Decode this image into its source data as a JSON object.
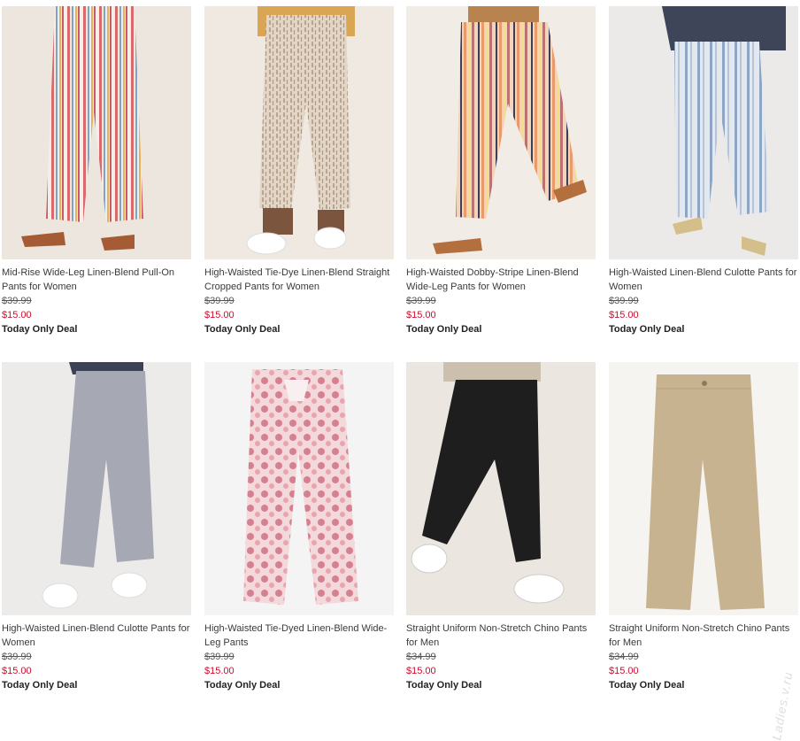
{
  "products": [
    {
      "title": "Mid-Rise Wide-Leg Linen-Blend Pull-On Pants for Women",
      "was_price": "$39.99",
      "price": "$15.00",
      "deal": "Today Only Deal",
      "image": "striped-wide-leg-pants-red-blue"
    },
    {
      "title": "High-Waisted Tie-Dye Linen-Blend Straight Cropped Pants for Women",
      "was_price": "$39.99",
      "price": "$15.00",
      "deal": "Today Only Deal",
      "image": "tie-dye-cropped-pants-beige"
    },
    {
      "title": "High-Waisted Dobby-Stripe Linen-Blend Wide-Leg Pants for Women",
      "was_price": "$39.99",
      "price": "$15.00",
      "deal": "Today Only Deal",
      "image": "dobby-stripe-wide-leg-pants-multicolor"
    },
    {
      "title": "High-Waisted Linen-Blend Culotte Pants for Women",
      "was_price": "$39.99",
      "price": "$15.00",
      "deal": "Today Only Deal",
      "image": "striped-culotte-pants-blue"
    },
    {
      "title": "High-Waisted Linen-Blend Culotte Pants for Women",
      "was_price": "$39.99",
      "price": "$15.00",
      "deal": "Today Only Deal",
      "image": "culotte-pants-gray"
    },
    {
      "title": "High-Waisted Tie-Dyed Linen-Blend Wide-Leg Pants",
      "was_price": "$39.99",
      "price": "$15.00",
      "deal": "Today Only Deal",
      "image": "tie-dyed-wide-leg-pants-pink"
    },
    {
      "title": "Straight Uniform Non-Stretch Chino Pants for Men",
      "was_price": "$34.99",
      "price": "$15.00",
      "deal": "Today Only Deal",
      "image": "chino-pants-black"
    },
    {
      "title": "Straight Uniform Non-Stretch Chino Pants for Men",
      "was_price": "$34.99",
      "price": "$15.00",
      "deal": "Today Only Deal",
      "image": "chino-pants-khaki"
    }
  ],
  "watermark": "Ladies.v.ru",
  "colors": {
    "sale_price": "#c8102e",
    "text": "#3a3a3a"
  }
}
